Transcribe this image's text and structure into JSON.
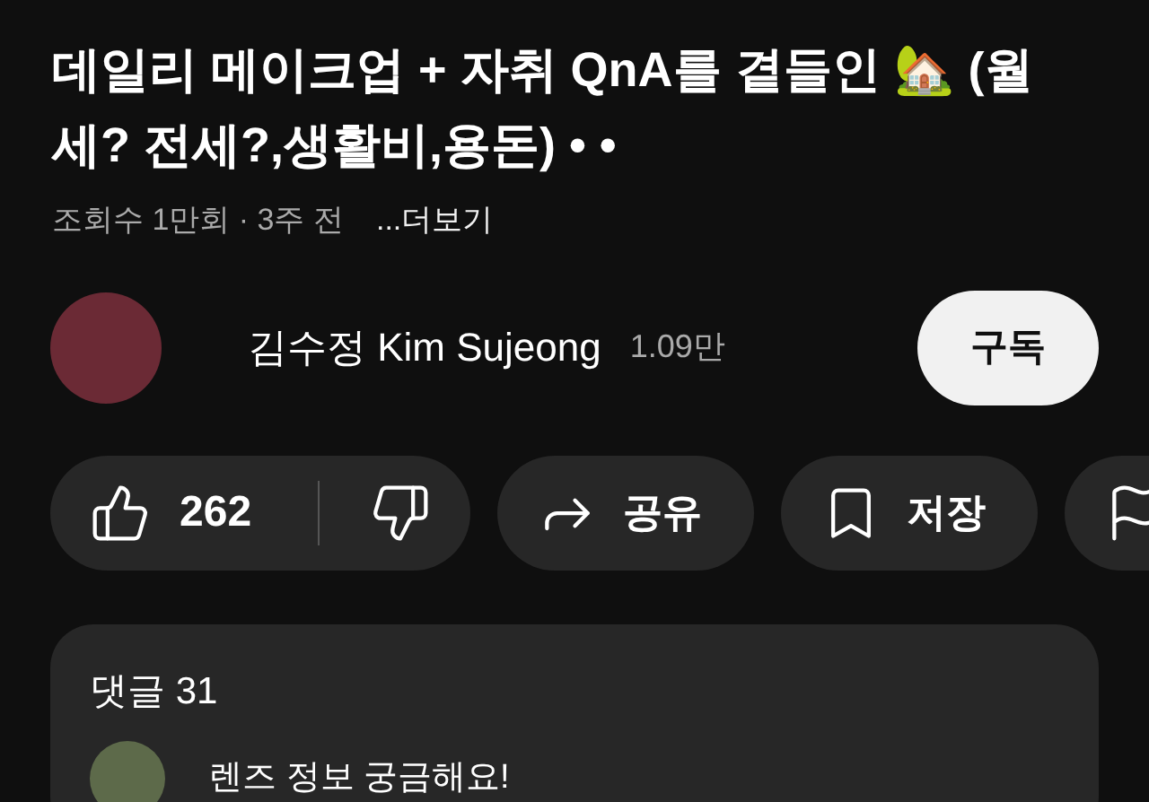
{
  "video": {
    "title": "데일리 메이크업 + 자취 QnA를 곁들인 🏡 (월세? 전세?,생활비,용돈) • •",
    "views": "조회수 1만회 · 3주 전",
    "more": "...더보기"
  },
  "channel": {
    "name": "김수정 Kim Sujeong",
    "subscribers": "1.09만",
    "subscribe_label": "구독"
  },
  "actions": [
    {
      "kind": "rating",
      "likes": "262"
    },
    {
      "kind": "share",
      "label": "공유"
    },
    {
      "kind": "save",
      "label": "저장"
    },
    {
      "kind": "report"
    }
  ],
  "comments": {
    "title": "댓글 31",
    "top_comment": "렌즈 정보 궁금해요!"
  }
}
